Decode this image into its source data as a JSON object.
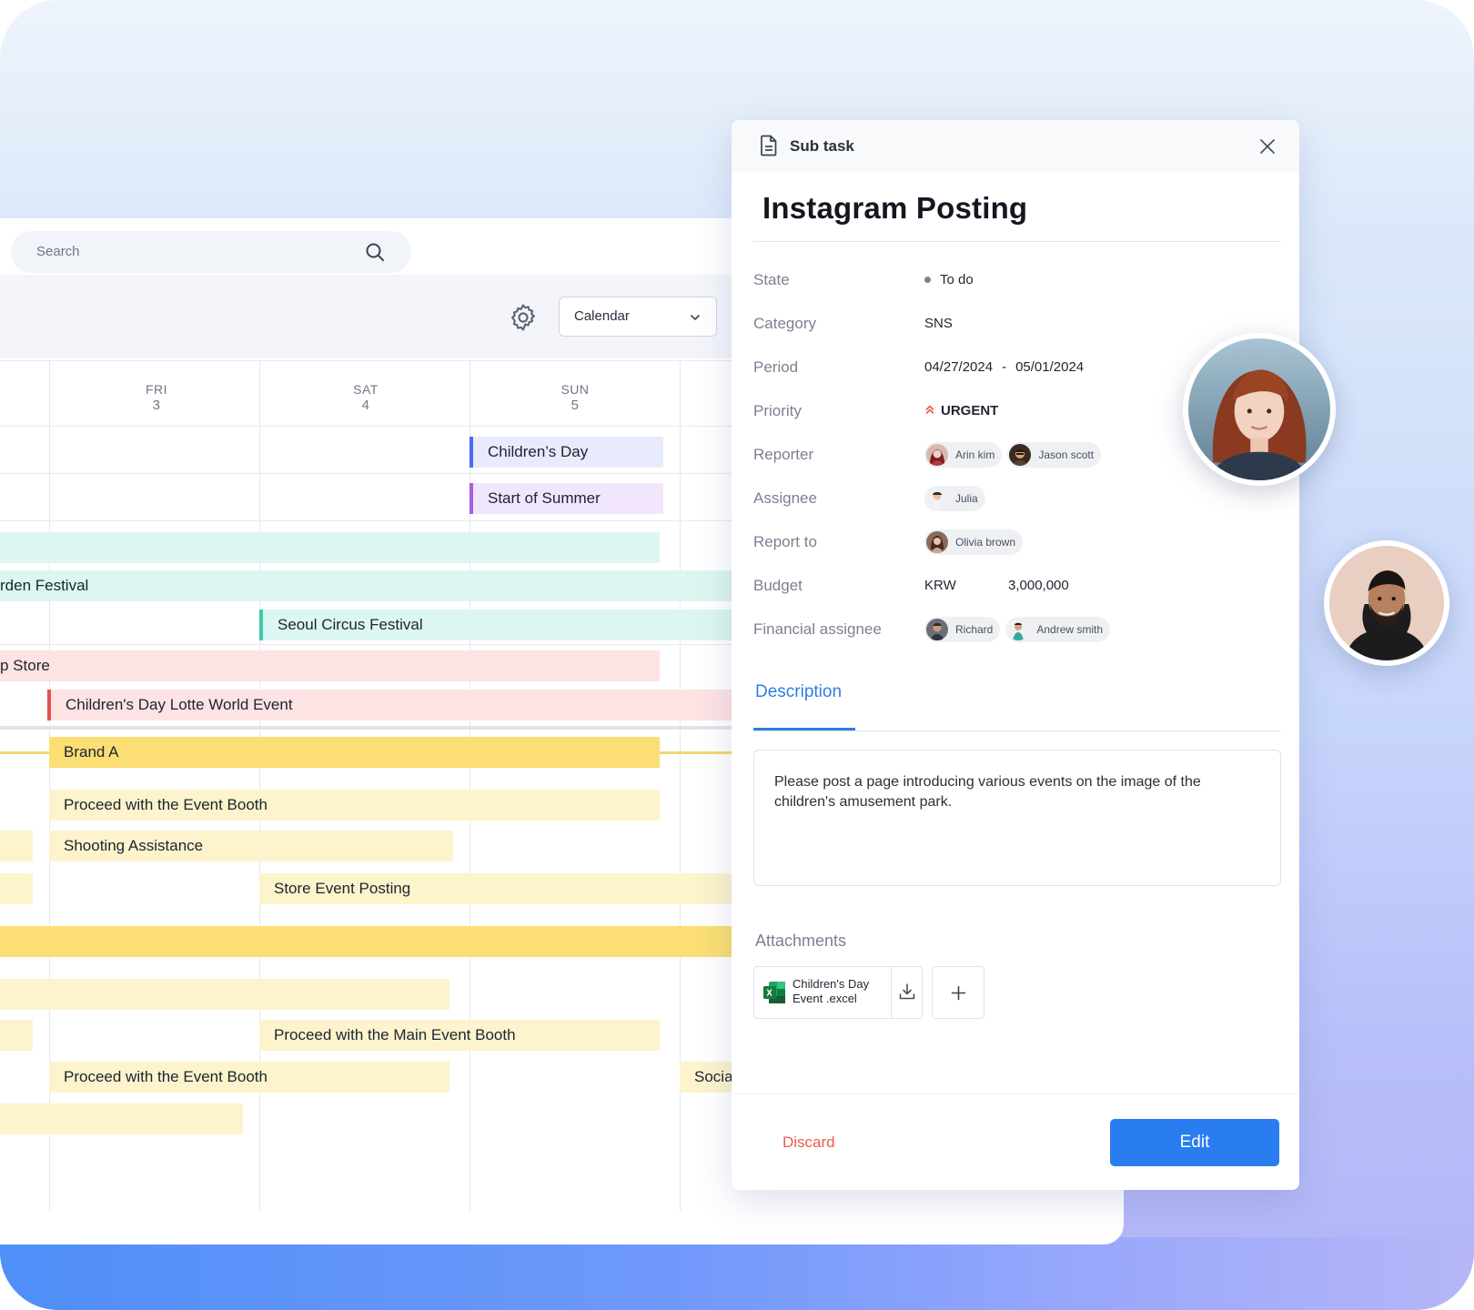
{
  "calendar": {
    "search_placeholder": "Search",
    "view_select": "Calendar",
    "days": [
      {
        "name": "FRI",
        "date": "3"
      },
      {
        "name": "SAT",
        "date": "4"
      },
      {
        "name": "SUN",
        "date": "5"
      }
    ],
    "events": {
      "childrens_day": "Children’s Day",
      "start_of_summer": "Start of Summer",
      "garden_festival": "rden Festival",
      "seoul_circus": "Seoul Circus Festival",
      "pop_store": "p Store",
      "lotte_world": "Children's Day Lotte World Event",
      "brand_a": "Brand A",
      "event_booth_1": "Proceed with the Event Booth",
      "shooting": "Shooting Assistance",
      "store_posting": "Store Event Posting",
      "main_booth": "Proceed with the Main Event Booth",
      "event_booth_2": "Proceed with the Event Booth",
      "social": "Socia"
    },
    "colors": {
      "blue_bar": "#e7ebfb",
      "blue_accent": "#4a6cf0",
      "purple_bar": "#f1e6fb",
      "purple_accent": "#a65ee0",
      "teal_bar": "#dcf6f1",
      "teal_accent": "#3ec8b0",
      "pink_bar": "#fde3e3",
      "red_accent": "#e5534b",
      "gold_bar": "#fbde74",
      "cream_bar": "#fdf3cc"
    }
  },
  "subtask": {
    "header_label": "Sub task",
    "title": "Instagram Posting",
    "fields": {
      "state": {
        "label": "State",
        "value": "To do"
      },
      "category": {
        "label": "Category",
        "value": "SNS"
      },
      "period": {
        "label": "Period",
        "start": "04/27/2024",
        "separator": "-",
        "end": "05/01/2024"
      },
      "priority": {
        "label": "Priority",
        "value": "URGENT",
        "color": "#ec5b4c"
      },
      "reporter": {
        "label": "Reporter",
        "people": [
          "Arin kim",
          "Jason scott"
        ]
      },
      "assignee": {
        "label": "Assignee",
        "people": [
          "Julia"
        ]
      },
      "report_to": {
        "label": "Report to",
        "people": [
          "Olivia brown"
        ]
      },
      "budget": {
        "label": "Budget",
        "currency": "KRW",
        "amount": "3,000,000"
      },
      "financial_assignee": {
        "label": "Financial assignee",
        "people": [
          "Richard",
          "Andrew smith"
        ]
      }
    },
    "tab_description": "Description",
    "description_text": "Please post a page introducing various events on the image of the children's amusement park.",
    "attachments_label": "Attachments",
    "attachment_name": "Children's Day Event .excel",
    "discard_label": "Discard",
    "edit_label": "Edit",
    "accent_color": "#2a7df0"
  }
}
